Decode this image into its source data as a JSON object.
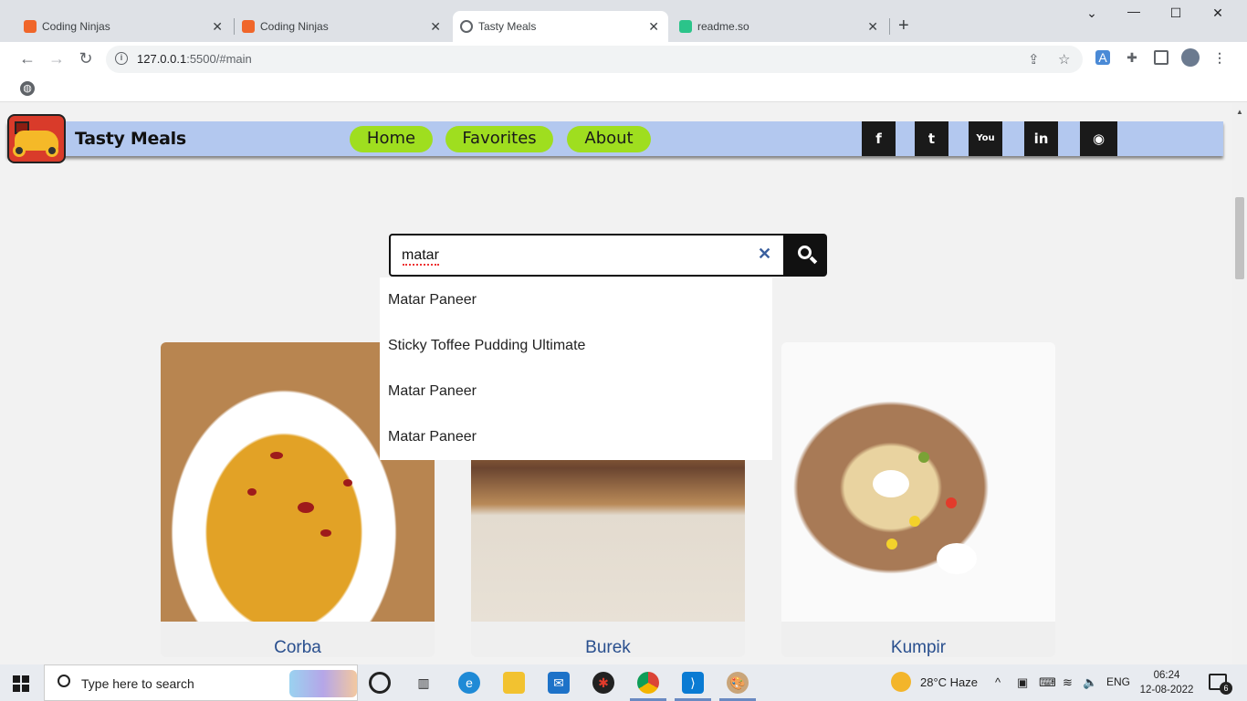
{
  "browser": {
    "tabs": [
      {
        "title": "Coding Ninjas",
        "favicon_color": "#f0662a"
      },
      {
        "title": "Coding Ninjas",
        "favicon_color": "#f0662a"
      },
      {
        "title": "Tasty Meals",
        "favicon_color": "#5f6368"
      },
      {
        "title": "readme.so",
        "favicon_color": "#2bc48a"
      }
    ],
    "active_tab": 2,
    "url_host": "127.0.0.1",
    "url_rest": ":5500/#main"
  },
  "site": {
    "brand": "Tasty Meals",
    "nav": [
      {
        "label": "Home"
      },
      {
        "label": "Favorites"
      },
      {
        "label": "About"
      }
    ],
    "social": [
      {
        "icon": "facebook-icon",
        "glyph": "f"
      },
      {
        "icon": "twitter-icon",
        "glyph": "t"
      },
      {
        "icon": "youtube-icon",
        "glyph": "You"
      },
      {
        "icon": "linkedin-icon",
        "glyph": "in"
      },
      {
        "icon": "github-icon",
        "glyph": "◉"
      }
    ],
    "accent_color": "#9fde1f",
    "navbar_color": "#b3c8ef"
  },
  "search": {
    "value": "matar",
    "suggestions": [
      "Matar Paneer",
      "Sticky Toffee Pudding Ultimate",
      "Matar Paneer",
      "Matar Paneer"
    ]
  },
  "meals": [
    {
      "name": "Corba"
    },
    {
      "name": "Burek"
    },
    {
      "name": "Kumpir"
    }
  ],
  "taskbar": {
    "search_placeholder": "Type here to search",
    "weather": "28°C  Haze",
    "language": "ENG",
    "time": "06:24",
    "date": "12-08-2022",
    "notifications": "6"
  }
}
